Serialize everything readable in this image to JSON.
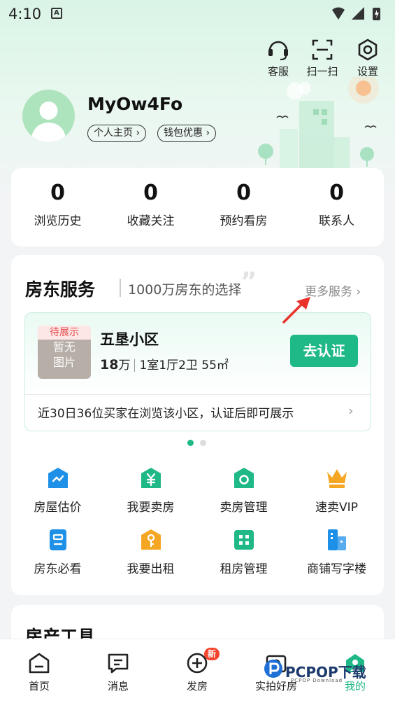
{
  "status_bar": {
    "time": "4:10",
    "notif_letter": "A"
  },
  "top_actions": [
    {
      "label": "客服",
      "icon": "headset-icon"
    },
    {
      "label": "扫一扫",
      "icon": "scan-icon"
    },
    {
      "label": "设置",
      "icon": "gear-icon"
    }
  ],
  "profile": {
    "username": "MyOw4Fo",
    "home_label": "个人主页 ›",
    "wallet_label": "钱包优惠 ›"
  },
  "stats": [
    {
      "value": "0",
      "label": "浏览历史"
    },
    {
      "value": "0",
      "label": "收藏关注"
    },
    {
      "value": "0",
      "label": "预约看房"
    },
    {
      "value": "0",
      "label": "联系人"
    }
  ],
  "landlord": {
    "title": "房东服务",
    "subtitle": "1000万房东的选择",
    "more": "更多服务 ›",
    "property": {
      "tag": "待展示",
      "placeholder_line1": "暂无",
      "placeholder_line2": "图片",
      "name": "五垦小区",
      "price": "18",
      "price_unit": "万",
      "layout": "1室1厅2卫 55㎡",
      "button": "去认证",
      "note": "近30日36位买家在浏览该小区，认证后即可展示",
      "note_chevron": "›"
    },
    "carousel": {
      "active": 0,
      "count": 2
    },
    "services": [
      {
        "label": "房屋估价",
        "icon": "house-valuation-icon"
      },
      {
        "label": "我要卖房",
        "icon": "sell-house-icon"
      },
      {
        "label": "卖房管理",
        "icon": "sale-management-icon"
      },
      {
        "label": "速卖VIP",
        "icon": "crown-icon"
      },
      {
        "label": "房东必看",
        "icon": "landlord-guide-icon"
      },
      {
        "label": "我要出租",
        "icon": "rent-out-icon"
      },
      {
        "label": "租房管理",
        "icon": "rental-management-icon"
      },
      {
        "label": "商铺写字楼",
        "icon": "office-building-icon"
      }
    ]
  },
  "tools": {
    "title": "房产工具"
  },
  "tabbar": {
    "items": [
      {
        "label": "首页",
        "icon": "home-icon"
      },
      {
        "label": "消息",
        "icon": "message-icon"
      },
      {
        "label": "发房",
        "icon": "add-icon",
        "badge": "新"
      },
      {
        "label": "实拍好房",
        "icon": "camera-icon"
      },
      {
        "label": "我的",
        "icon": "profile-icon",
        "active": true
      }
    ]
  },
  "watermark": {
    "title": "PCPOP下载",
    "sub": "PCPOP Download"
  },
  "colors": {
    "accent": "#1fb887",
    "badge": "#f5442c",
    "tag_text": "#e84a4a",
    "icon_blue": "#1e90e8",
    "icon_orange": "#f5a623"
  }
}
